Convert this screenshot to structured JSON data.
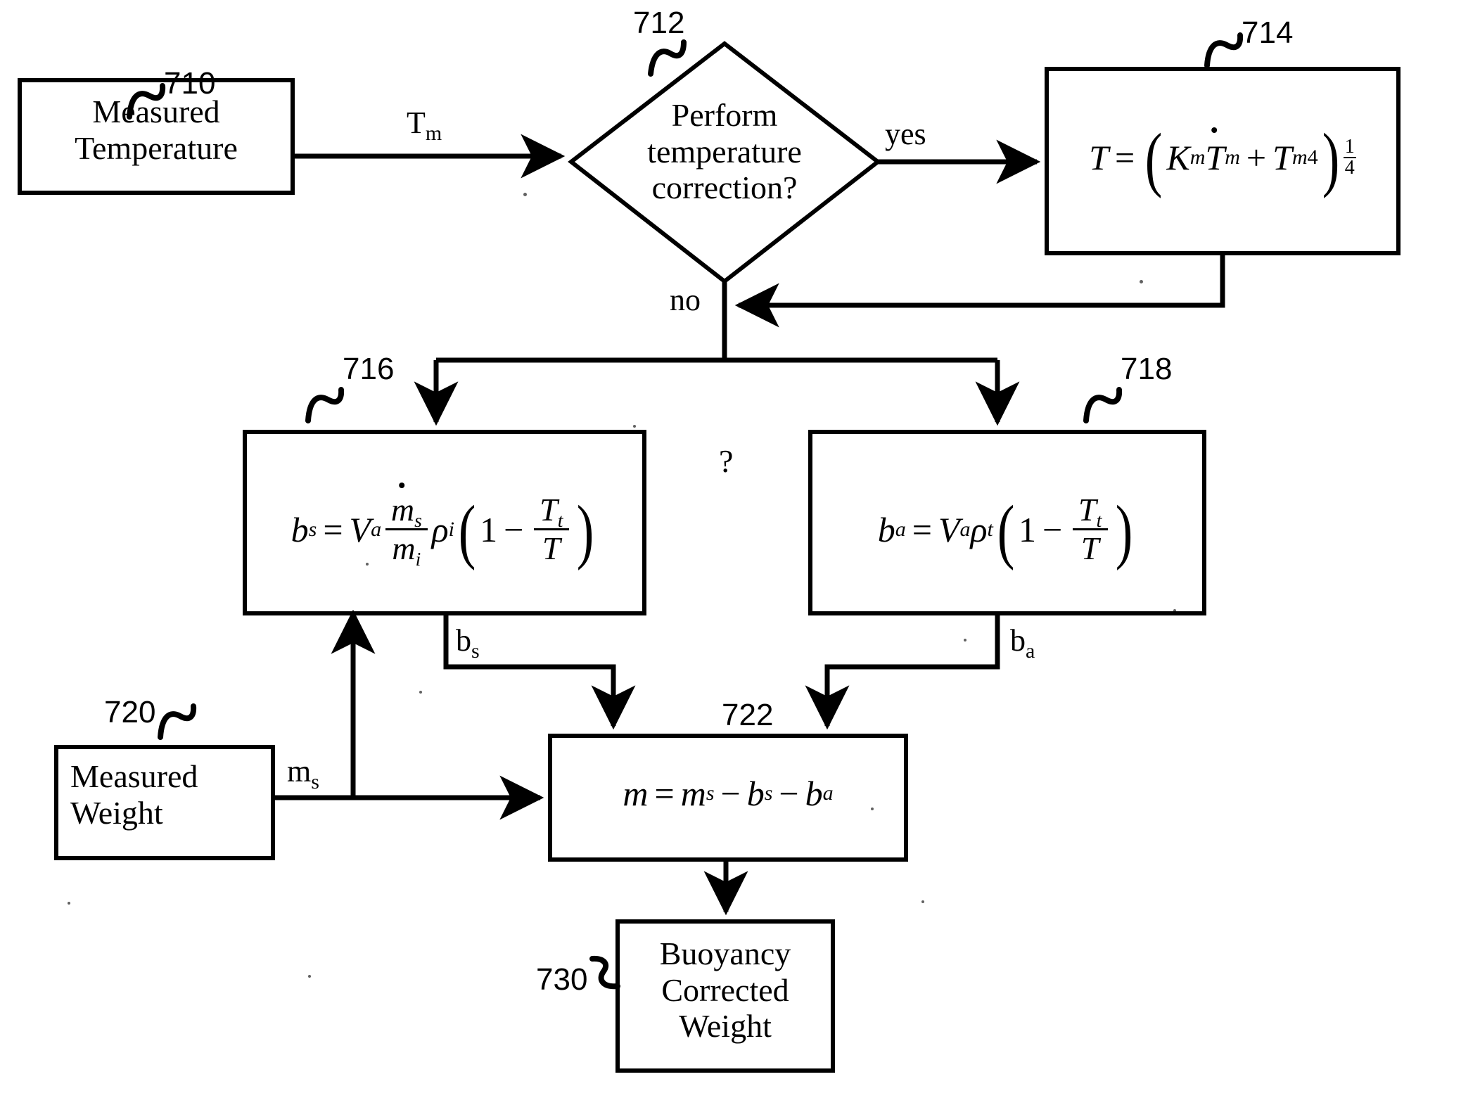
{
  "figure": {
    "type": "patent-flowchart",
    "title": "Buoyancy corrected weight calculation flow"
  },
  "nodes": {
    "measured_temperature": {
      "ref": "710",
      "shape": "rectangle",
      "line1": "Measured",
      "line2": "Temperature"
    },
    "decision": {
      "ref": "712",
      "shape": "diamond",
      "line1": "Perform",
      "line2": "temperature",
      "line3": "correction?"
    },
    "temp_correction": {
      "ref": "714",
      "shape": "rectangle",
      "equation_plain": "T = (K_m Ṫ_m + T_m^4)^(1/4)",
      "lhs": "T",
      "eq": "=",
      "K": "K",
      "K_sub": "m",
      "Tdot": "T",
      "Tdot_sub": "m",
      "plus": "+",
      "T2": "T",
      "T2_sub": "m",
      "T2_sup": "4",
      "exp_num": "1",
      "exp_den": "4"
    },
    "bs_box": {
      "ref": "716",
      "shape": "rectangle",
      "equation_plain": "b_s = V_a (ṁ_s / m_i) ρ_i (1 − T_t / T)",
      "lhs": "b",
      "lhs_sub": "s",
      "eq": "=",
      "V": "V",
      "V_sub": "a",
      "num": "m",
      "num_sub": "s",
      "den": "m",
      "den_sub": "i",
      "rho": "ρ",
      "rho_sub": "i",
      "one": "1",
      "minus": "−",
      "Tt": "T",
      "Tt_sub": "t",
      "Tden": "T"
    },
    "ba_box": {
      "ref": "718",
      "shape": "rectangle",
      "equation_plain": "b_a = V_a ρ_t (1 − T_t / T)",
      "lhs": "b",
      "lhs_sub": "a",
      "eq": "=",
      "V": "V",
      "V_sub": "a",
      "rho": "ρ",
      "rho_sub": "t",
      "one": "1",
      "minus": "−",
      "Tt": "T",
      "Tt_sub": "t",
      "Tden": "T"
    },
    "measured_weight": {
      "ref": "720",
      "shape": "rectangle",
      "line1": "Measured",
      "line2": "Weight"
    },
    "mass_box": {
      "ref": "722",
      "shape": "rectangle",
      "equation_plain": "m = m_s − b_s − b_a",
      "lhs": "m",
      "eq": "=",
      "ms": "m",
      "ms_sub": "s",
      "minus1": "−",
      "bs": "b",
      "bs_sub": "s",
      "minus2": "−",
      "ba": "b",
      "ba_sub": "a"
    },
    "result": {
      "ref": "730",
      "shape": "rectangle",
      "line1": "Buoyancy",
      "line2": "Corrected",
      "line3": "Weight"
    }
  },
  "edge_labels": {
    "tm": {
      "base": "T",
      "sub": "m"
    },
    "yes": "yes",
    "no": "no",
    "bs": {
      "base": "b",
      "sub": "s"
    },
    "ba": {
      "base": "b",
      "sub": "a"
    },
    "ms": {
      "base": "m",
      "sub": "s"
    }
  },
  "annotations": {
    "question_mark": "?"
  },
  "colors": {
    "stroke": "#000000",
    "fill": "#ffffff",
    "background": "#ffffff"
  }
}
